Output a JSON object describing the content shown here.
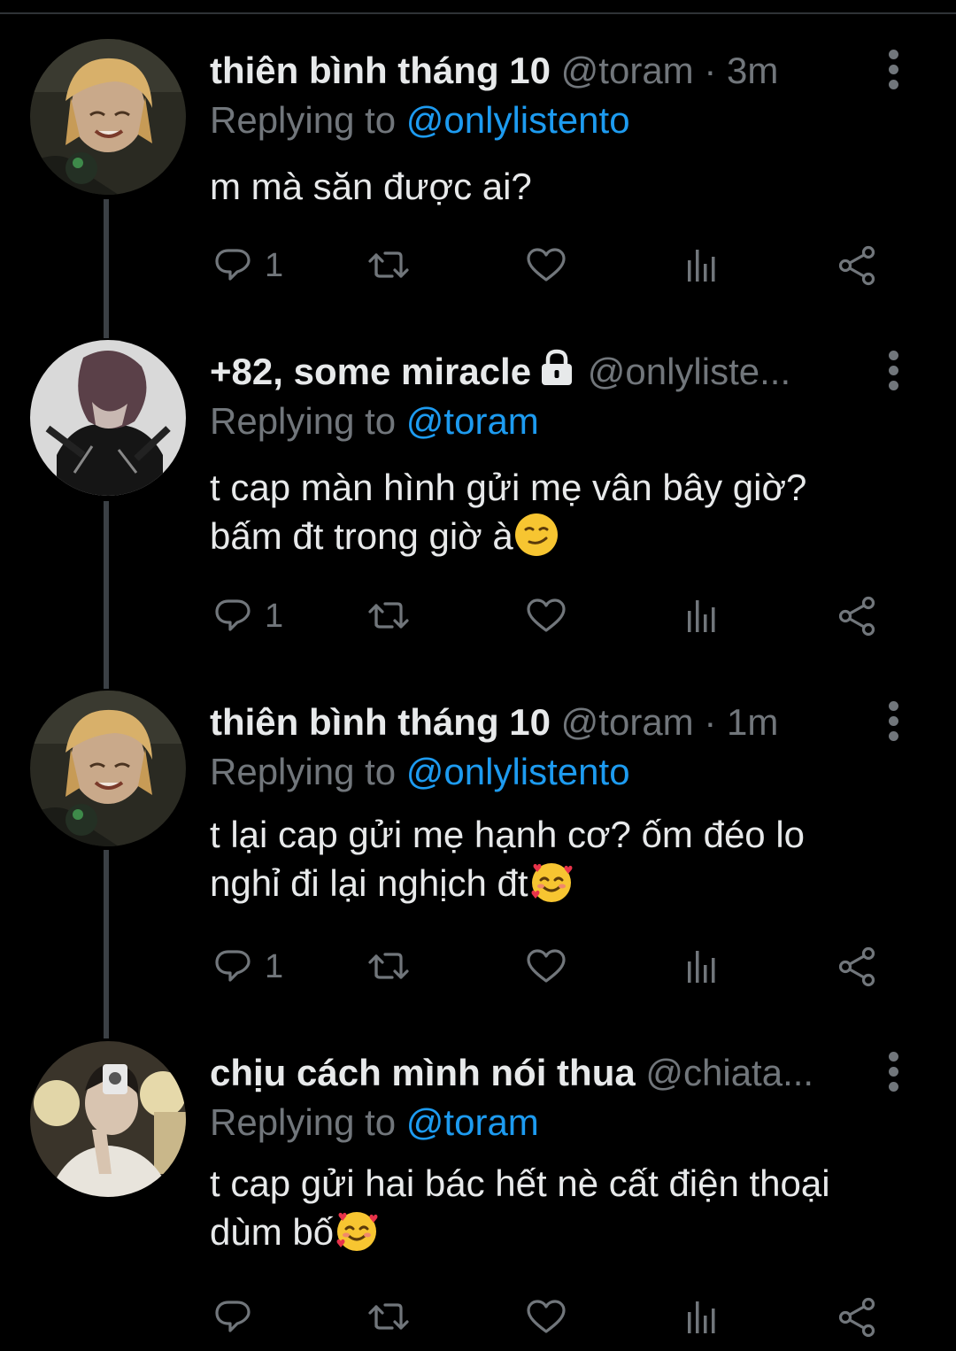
{
  "colors": {
    "background": "#000000",
    "text": "#e7e9ea",
    "muted": "#71767b",
    "accent": "#1d9bf0",
    "thread_line": "#3b4045"
  },
  "tweets": [
    {
      "name": "thiên bình tháng 10",
      "handle": "@toram",
      "time": "· 3m",
      "replying_label": "Replying to",
      "replying_to": "@onlylistento",
      "text_lines": [
        "m mà săn được ai?"
      ],
      "reply_count": "1",
      "icons": [
        "reply-icon",
        "retweet-icon",
        "like-icon",
        "analytics-icon",
        "share-icon",
        "more-icon"
      ]
    },
    {
      "name": "+82, some miracle",
      "handle": "@onlyliste...",
      "time": "",
      "locked": true,
      "replying_label": "Replying to",
      "replying_to": "@toram",
      "text_lines": [
        "t cap màn hình gửi mẹ vân bây giờ?",
        "bấm đt trong giờ à"
      ],
      "emoji": "smirking-face",
      "reply_count": "1",
      "icons": [
        "reply-icon",
        "retweet-icon",
        "like-icon",
        "analytics-icon",
        "share-icon",
        "more-icon"
      ]
    },
    {
      "name": "thiên bình tháng 10",
      "handle": "@toram",
      "time": "· 1m",
      "replying_label": "Replying to",
      "replying_to": "@onlylistento",
      "text_lines": [
        "t lại cap gửi mẹ hạnh cơ? ốm đéo lo",
        "nghỉ đi lại nghịch đt"
      ],
      "emoji": "smiling-face-with-hearts",
      "reply_count": "1",
      "icons": [
        "reply-icon",
        "retweet-icon",
        "like-icon",
        "analytics-icon",
        "share-icon",
        "more-icon"
      ]
    },
    {
      "name": "chịu cách mình nói thua",
      "handle": "@chiata...",
      "time": "",
      "replying_label": "Replying to",
      "replying_to": "@toram",
      "text_lines": [
        "t cap gửi hai bác hết nè cất điện thoại",
        "dùm bố"
      ],
      "emoji": "smiling-face-with-hearts",
      "reply_count": "",
      "icons": [
        "reply-icon",
        "retweet-icon",
        "like-icon",
        "analytics-icon",
        "share-icon",
        "more-icon"
      ]
    }
  ]
}
